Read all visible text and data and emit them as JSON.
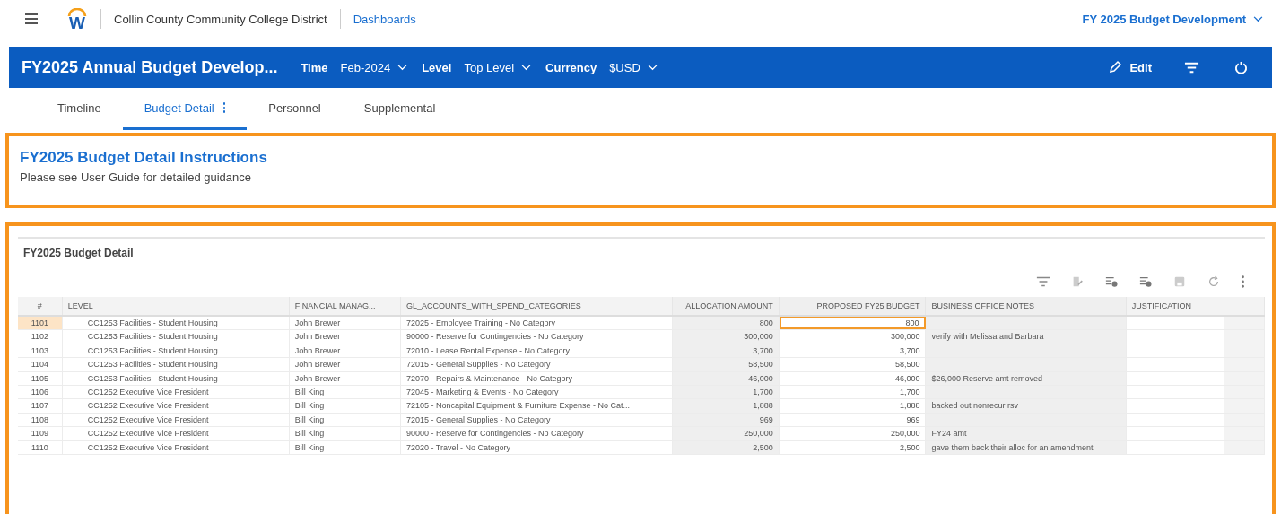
{
  "top_bar": {
    "logo_letter": "W",
    "organization": "Collin County Community College District",
    "link": "Dashboards",
    "workspace": "FY 2025 Budget Development"
  },
  "header": {
    "title": "FY2025 Annual Budget Develop...",
    "filters": [
      {
        "label": "Time",
        "value": "Feb-2024"
      },
      {
        "label": "Level",
        "value": "Top Level"
      },
      {
        "label": "Currency",
        "value": "$USD"
      }
    ],
    "edit": "Edit"
  },
  "tabs": [
    {
      "label": "Timeline",
      "selected": false
    },
    {
      "label": "Budget Detail",
      "selected": true
    },
    {
      "label": "Personnel",
      "selected": false
    },
    {
      "label": "Supplemental",
      "selected": false
    }
  ],
  "instructions": {
    "title": "FY2025 Budget Detail Instructions",
    "text": "Please see User Guide for detailed guidance"
  },
  "table": {
    "title": "FY2025 Budget Detail",
    "columns": [
      "#",
      "LEVEL",
      "FINANCIAL MANAG...",
      "GL_ACCOUNTS_WITH_SPEND_CATEGORIES",
      "ALLOCATION AMOUNT",
      "PROPOSED FY25 BUDGET",
      "BUSINESS OFFICE NOTES",
      "JUSTIFICATION"
    ],
    "rows": [
      {
        "cells": [
          "1101",
          "CC1253 Facilities - Student Housing",
          "John Brewer",
          "72025 - Employee Training -  No Category",
          "800",
          "800",
          "",
          ""
        ],
        "selected": true
      },
      {
        "cells": [
          "1102",
          "CC1253 Facilities - Student Housing",
          "John Brewer",
          "90000 - Reserve for Contingencies - No Category",
          "300,000",
          "300,000",
          "verify with Melissa and Barbara",
          ""
        ],
        "selected": false
      },
      {
        "cells": [
          "1103",
          "CC1253 Facilities - Student Housing",
          "John Brewer",
          "72010 - Lease Rental Expense -  No Category",
          "3,700",
          "3,700",
          "",
          ""
        ],
        "selected": false
      },
      {
        "cells": [
          "1104",
          "CC1253 Facilities - Student Housing",
          "John Brewer",
          "72015 - General Supplies -  No Category",
          "58,500",
          "58,500",
          "",
          ""
        ],
        "selected": false
      },
      {
        "cells": [
          "1105",
          "CC1253 Facilities - Student Housing",
          "John Brewer",
          "72070 - Repairs & Maintenance -  No Category",
          "46,000",
          "46,000",
          "$26,000 Reserve amt removed",
          ""
        ],
        "selected": false
      },
      {
        "cells": [
          "1106",
          "CC1252 Executive Vice President",
          "Bill King",
          "72045 - Marketing & Events -  No Category",
          "1,700",
          "1,700",
          "",
          ""
        ],
        "selected": false
      },
      {
        "cells": [
          "1107",
          "CC1252 Executive Vice President",
          "Bill King",
          "72105 - Noncapital Equipment & Furniture Expense -  No Cat...",
          "1,888",
          "1,888",
          "backed out nonrecur rsv",
          ""
        ],
        "selected": false
      },
      {
        "cells": [
          "1108",
          "CC1252 Executive Vice President",
          "Bill King",
          "72015 - General Supplies -  No Category",
          "969",
          "969",
          "",
          ""
        ],
        "selected": false
      },
      {
        "cells": [
          "1109",
          "CC1252 Executive Vice President",
          "Bill King",
          "90000 - Reserve for Contingencies - No Category",
          "250,000",
          "250,000",
          "FY24 amt",
          ""
        ],
        "selected": false
      },
      {
        "cells": [
          "1110",
          "CC1252 Executive Vice President",
          "Bill King",
          "72020 - Travel -  No Category",
          "2,500",
          "2,500",
          "gave them back their alloc for an amendment",
          ""
        ],
        "selected": false
      }
    ]
  }
}
